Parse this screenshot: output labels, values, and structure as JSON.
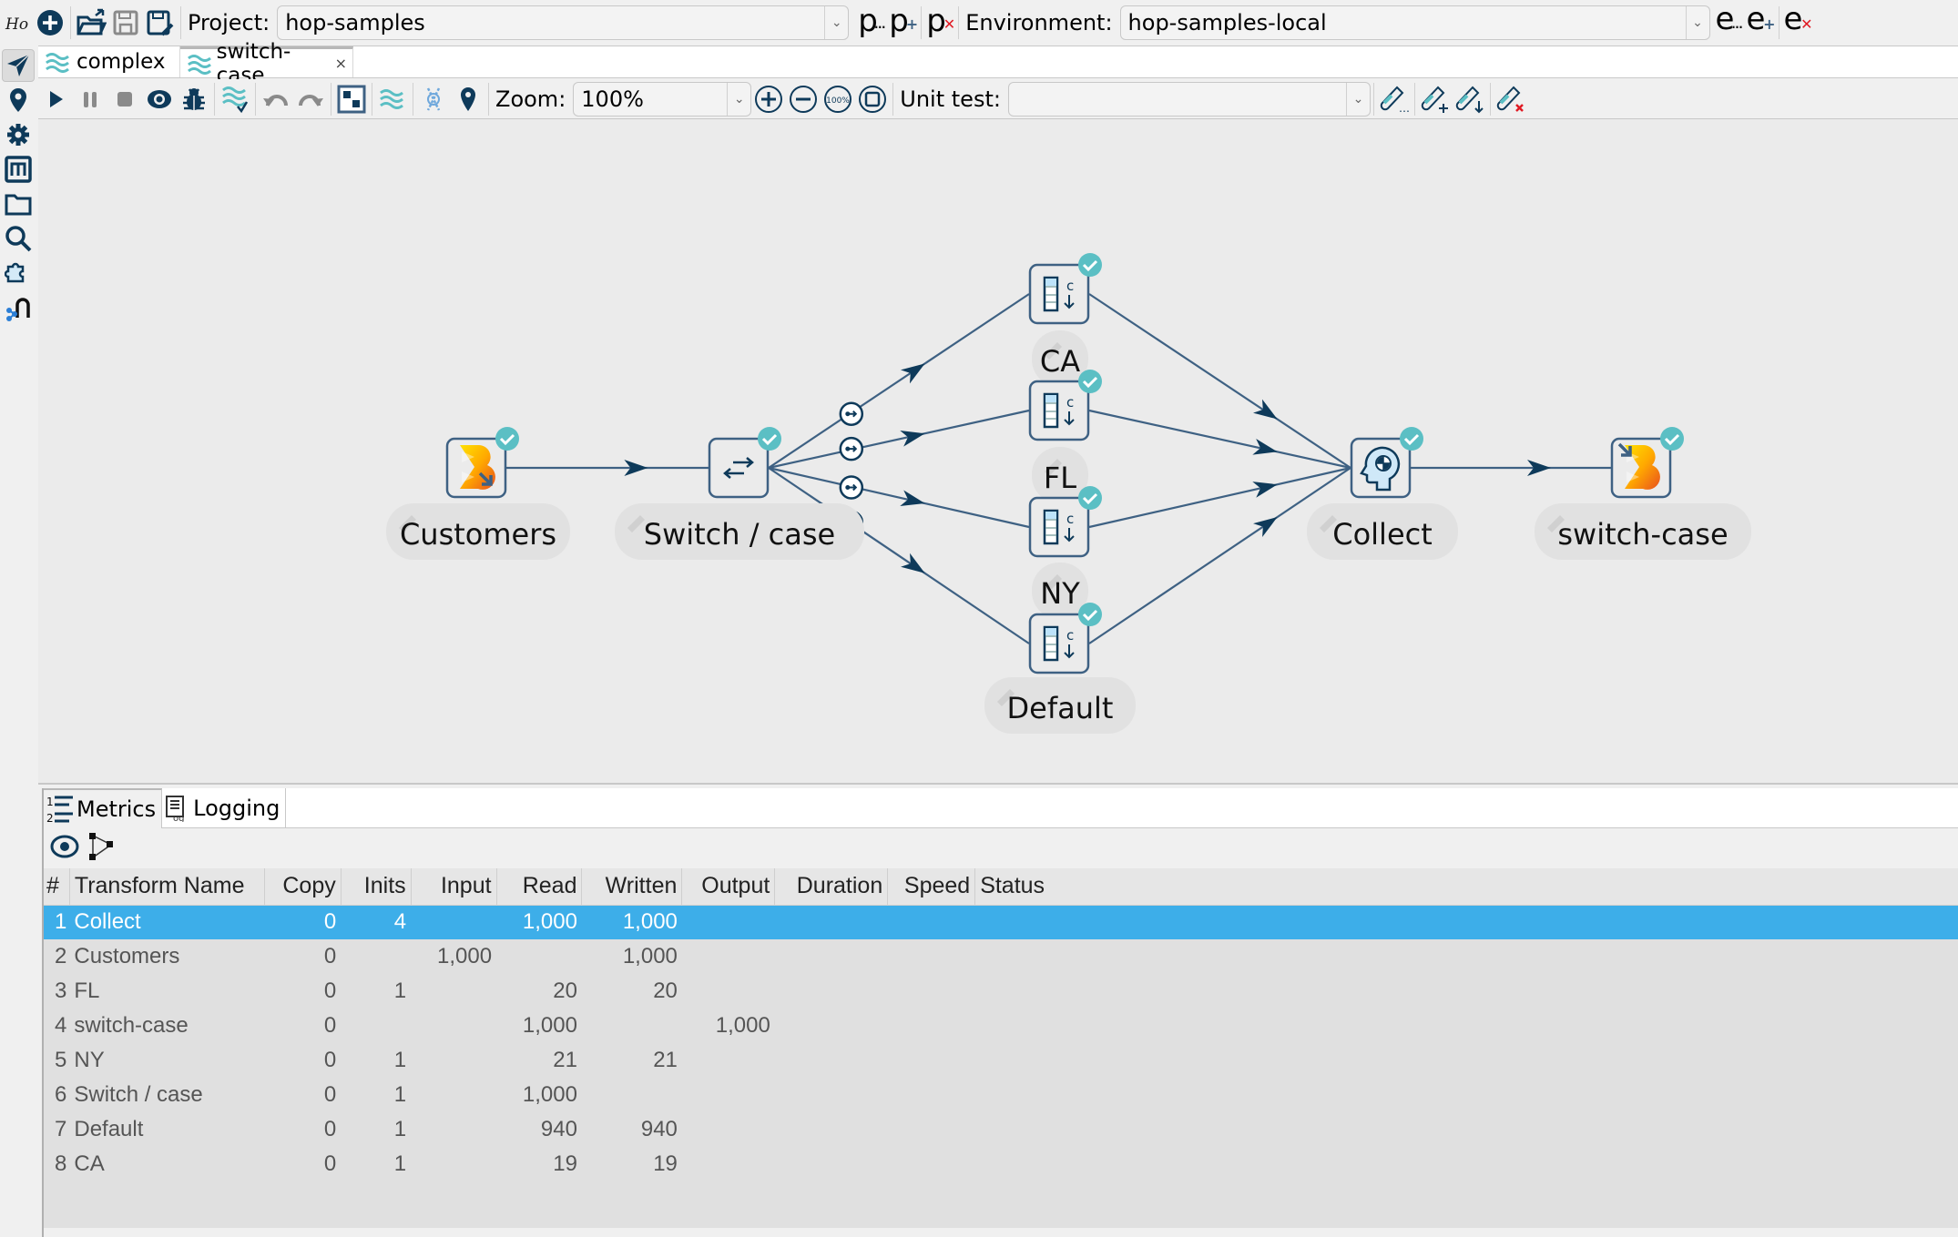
{
  "topbar": {
    "project_label": "Project:",
    "project_value": "hop-samples",
    "environment_label": "Environment:",
    "environment_value": "hop-samples-local",
    "project_icons": [
      {
        "name": "edit-project-icon",
        "letter": "p",
        "sub": "..."
      },
      {
        "name": "add-project-icon",
        "letter": "p",
        "sub": "+"
      },
      {
        "name": "delete-project-icon",
        "letter": "p",
        "sub": "×"
      }
    ],
    "environment_icons": [
      {
        "name": "edit-environment-icon",
        "letter": "e",
        "sub": "..."
      },
      {
        "name": "add-environment-icon",
        "letter": "e",
        "sub": "+"
      },
      {
        "name": "delete-environment-icon",
        "letter": "e",
        "sub": "×"
      }
    ]
  },
  "tabs": [
    {
      "label": "complex",
      "active": false
    },
    {
      "label": "switch-case",
      "active": true,
      "close": "×"
    }
  ],
  "runbar": {
    "zoom_label": "Zoom:",
    "zoom_value": "100%",
    "unit_test_label": "Unit test:",
    "unit_test_value": ""
  },
  "colors": {
    "accent": "#3daee9",
    "hop_line": "#3e6183",
    "arrow": "#0e3a5a",
    "check": "#5bbfc4",
    "node_border": "#3e6183",
    "canvas_bg": "#ebebeb",
    "delete_red": "#e01b24"
  },
  "pipeline": {
    "nodes": [
      {
        "id": "customers",
        "label": "Customers",
        "type": "input"
      },
      {
        "id": "switch",
        "label": "Switch / case",
        "type": "switch"
      },
      {
        "id": "ca",
        "label": "CA",
        "type": "constant"
      },
      {
        "id": "fl",
        "label": "FL",
        "type": "constant"
      },
      {
        "id": "ny",
        "label": "NY",
        "type": "constant"
      },
      {
        "id": "default",
        "label": "Default",
        "type": "constant"
      },
      {
        "id": "collect",
        "label": "Collect",
        "type": "collect"
      },
      {
        "id": "output",
        "label": "switch-case",
        "type": "output"
      }
    ],
    "hops": [
      {
        "from": "customers",
        "to": "switch"
      },
      {
        "from": "switch",
        "to": "ca",
        "conditional": true
      },
      {
        "from": "switch",
        "to": "fl",
        "conditional": true
      },
      {
        "from": "switch",
        "to": "ny",
        "conditional": true
      },
      {
        "from": "switch",
        "to": "default",
        "conditional": true
      },
      {
        "from": "ca",
        "to": "collect"
      },
      {
        "from": "fl",
        "to": "collect"
      },
      {
        "from": "ny",
        "to": "collect"
      },
      {
        "from": "default",
        "to": "collect"
      },
      {
        "from": "collect",
        "to": "output"
      }
    ]
  },
  "bottom": {
    "tabs": [
      {
        "label": "Metrics",
        "active": true
      },
      {
        "label": "Logging",
        "active": false
      }
    ],
    "columns": [
      "#",
      "Transform Name",
      "Copy",
      "Inits",
      "Input",
      "Read",
      "Written",
      "Output",
      "Duration",
      "Speed",
      "Status"
    ],
    "rows": [
      {
        "n": "1",
        "name": "Collect",
        "copy": "0",
        "inits": "4",
        "input": "",
        "read": "1,000",
        "written": "1,000",
        "output": "",
        "duration": "",
        "speed": "",
        "status": "",
        "selected": true
      },
      {
        "n": "2",
        "name": "Customers",
        "copy": "0",
        "inits": "",
        "input": "1,000",
        "read": "",
        "written": "1,000",
        "output": "",
        "duration": "",
        "speed": "",
        "status": ""
      },
      {
        "n": "3",
        "name": "FL",
        "copy": "0",
        "inits": "1",
        "input": "",
        "read": "20",
        "written": "20",
        "output": "",
        "duration": "",
        "speed": "",
        "status": ""
      },
      {
        "n": "4",
        "name": "switch-case",
        "copy": "0",
        "inits": "",
        "input": "",
        "read": "1,000",
        "written": "",
        "output": "1,000",
        "duration": "",
        "speed": "",
        "status": ""
      },
      {
        "n": "5",
        "name": "NY",
        "copy": "0",
        "inits": "1",
        "input": "",
        "read": "21",
        "written": "21",
        "output": "",
        "duration": "",
        "speed": "",
        "status": ""
      },
      {
        "n": "6",
        "name": "Switch / case",
        "copy": "0",
        "inits": "1",
        "input": "",
        "read": "1,000",
        "written": "",
        "output": "",
        "duration": "",
        "speed": "",
        "status": ""
      },
      {
        "n": "7",
        "name": "Default",
        "copy": "0",
        "inits": "1",
        "input": "",
        "read": "940",
        "written": "940",
        "output": "",
        "duration": "",
        "speed": "",
        "status": ""
      },
      {
        "n": "8",
        "name": "CA",
        "copy": "0",
        "inits": "1",
        "input": "",
        "read": "19",
        "written": "19",
        "output": "",
        "duration": "",
        "speed": "",
        "status": ""
      }
    ]
  }
}
